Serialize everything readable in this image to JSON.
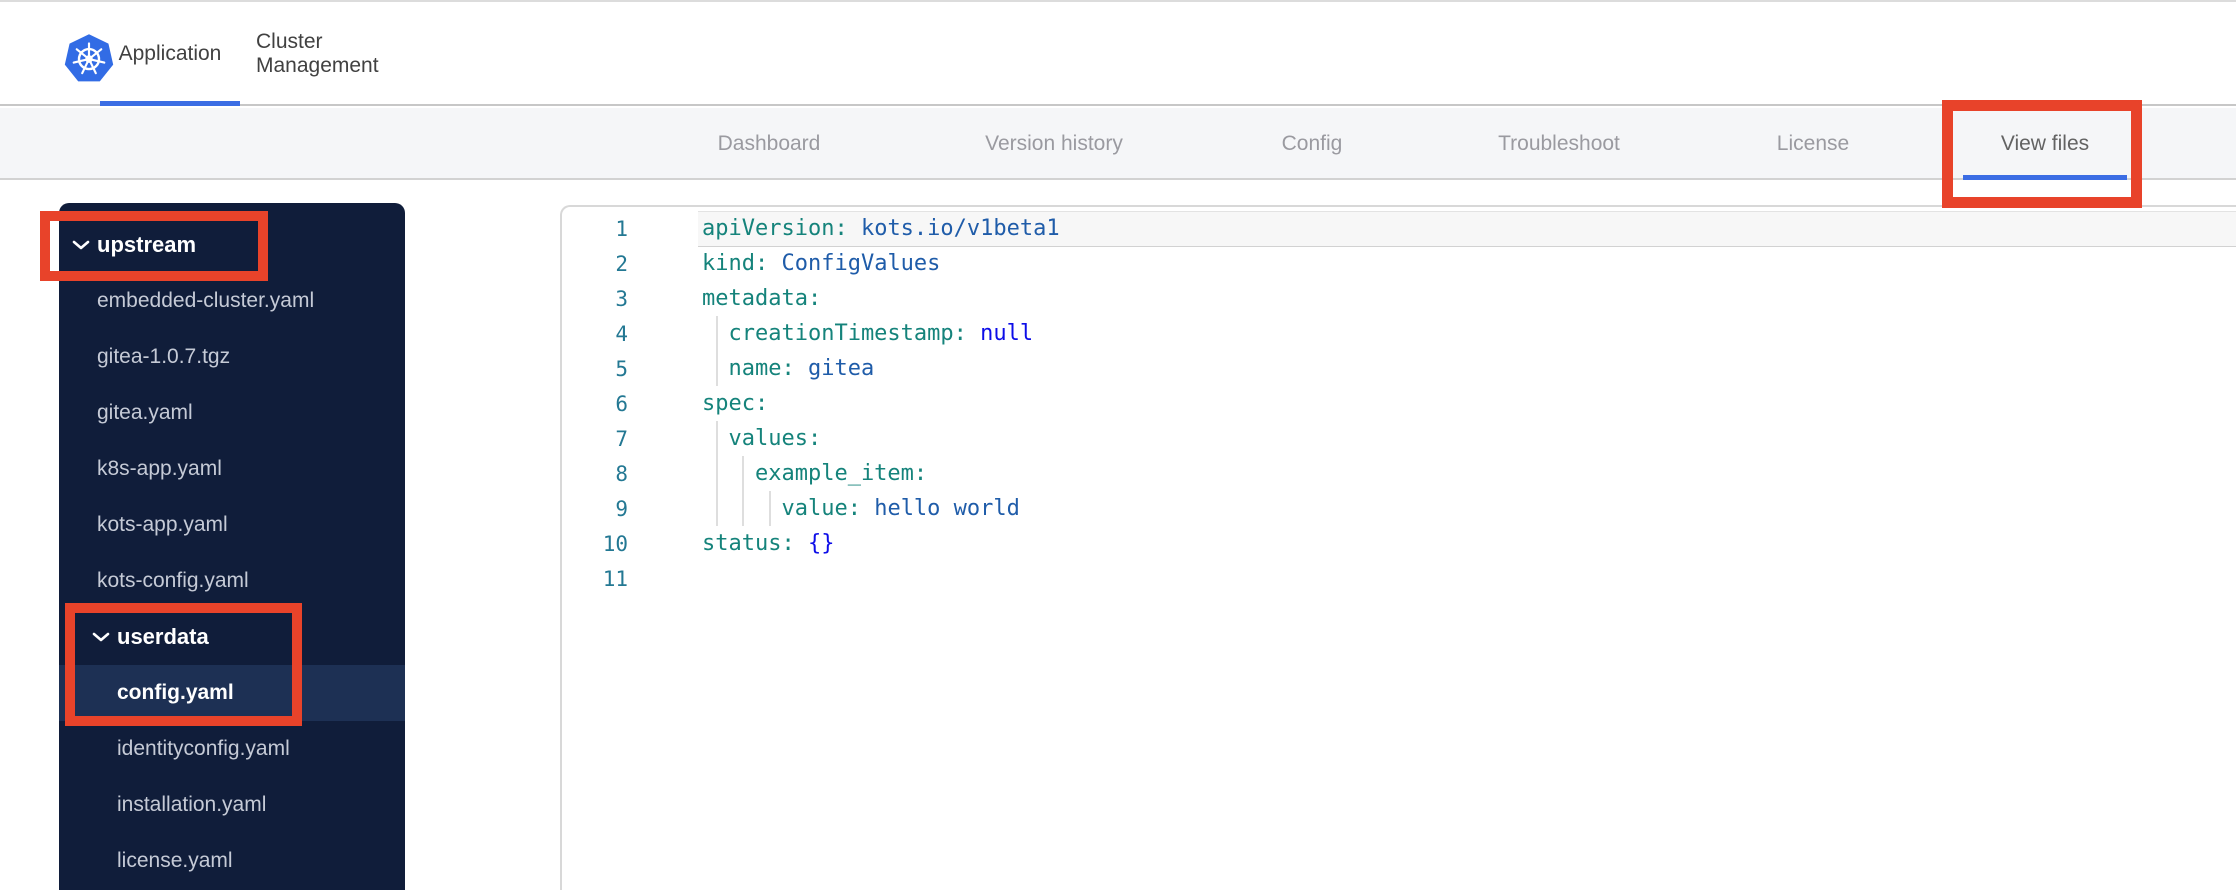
{
  "colors": {
    "accent-blue": "#3B6DE4",
    "k8s-blue": "#326CE5",
    "annotation-red": "#E8432A",
    "subnav-bg": "#F5F6F8",
    "sidebar-bg": "#101D3A",
    "sidebar-selected-bg": "#1D3054",
    "sidebar-file-text": "#C5CAD6",
    "code-key": "#15837B",
    "code-string": "#1F5CA9",
    "code-keyword": "#0D0DE8",
    "code-linenum": "#237893"
  },
  "header": {
    "logo_icon": "kubernetes-logo",
    "tabs": [
      {
        "label": "Application",
        "active": true
      },
      {
        "label": "Cluster Management",
        "active": false
      }
    ]
  },
  "subnav": {
    "tabs": [
      "Dashboard",
      "Version history",
      "Config",
      "Troubleshoot",
      "License",
      "View files"
    ],
    "active_tab": "View files"
  },
  "file_tree": {
    "items": [
      {
        "type": "folder",
        "name": "upstream",
        "level": 0,
        "expanded": true
      },
      {
        "type": "file",
        "name": "embedded-cluster.yaml",
        "level": 1
      },
      {
        "type": "file",
        "name": "gitea-1.0.7.tgz",
        "level": 1
      },
      {
        "type": "file",
        "name": "gitea.yaml",
        "level": 1
      },
      {
        "type": "file",
        "name": "k8s-app.yaml",
        "level": 1
      },
      {
        "type": "file",
        "name": "kots-app.yaml",
        "level": 1
      },
      {
        "type": "folder",
        "name": "kots-config.yaml",
        "level": 1,
        "is_plain_file": true
      },
      {
        "type": "folder",
        "name": "userdata",
        "level": 1,
        "expanded": true
      },
      {
        "type": "file",
        "name": "config.yaml",
        "level": 2,
        "selected": true
      },
      {
        "type": "file",
        "name": "identityconfig.yaml",
        "level": 2
      },
      {
        "type": "file",
        "name": "installation.yaml",
        "level": 2
      },
      {
        "type": "file",
        "name": "license.yaml",
        "level": 2
      }
    ]
  },
  "editor": {
    "language": "yaml",
    "lines": [
      {
        "num": "1",
        "indent": 0,
        "current": true,
        "tokens": [
          [
            "key",
            "apiVersion:"
          ],
          [
            "str",
            " kots.io/v1beta1"
          ]
        ]
      },
      {
        "num": "2",
        "indent": 0,
        "tokens": [
          [
            "key",
            "kind:"
          ],
          [
            "str",
            " ConfigValues"
          ]
        ]
      },
      {
        "num": "3",
        "indent": 0,
        "tokens": [
          [
            "key",
            "metadata:"
          ]
        ]
      },
      {
        "num": "4",
        "indent": 1,
        "tokens": [
          [
            "key",
            "  creationTimestamp:"
          ],
          [
            "kw",
            " null"
          ]
        ]
      },
      {
        "num": "5",
        "indent": 1,
        "tokens": [
          [
            "key",
            "  name:"
          ],
          [
            "str",
            " gitea"
          ]
        ]
      },
      {
        "num": "6",
        "indent": 0,
        "tokens": [
          [
            "key",
            "spec:"
          ]
        ]
      },
      {
        "num": "7",
        "indent": 1,
        "tokens": [
          [
            "key",
            "  values:"
          ]
        ]
      },
      {
        "num": "8",
        "indent": 2,
        "tokens": [
          [
            "key",
            "    example_item:"
          ]
        ]
      },
      {
        "num": "9",
        "indent": 3,
        "tokens": [
          [
            "key",
            "      value:"
          ],
          [
            "str",
            " hello world"
          ]
        ]
      },
      {
        "num": "10",
        "indent": 0,
        "tokens": [
          [
            "key",
            "status:"
          ],
          [
            "kw",
            " {}"
          ]
        ]
      },
      {
        "num": "11",
        "indent": 0,
        "tokens": []
      }
    ]
  },
  "annotations": {
    "highlight_color": "#E8432A",
    "highlighted": [
      "upstream folder",
      "userdata folder and config.yaml file",
      "View files tab"
    ]
  }
}
